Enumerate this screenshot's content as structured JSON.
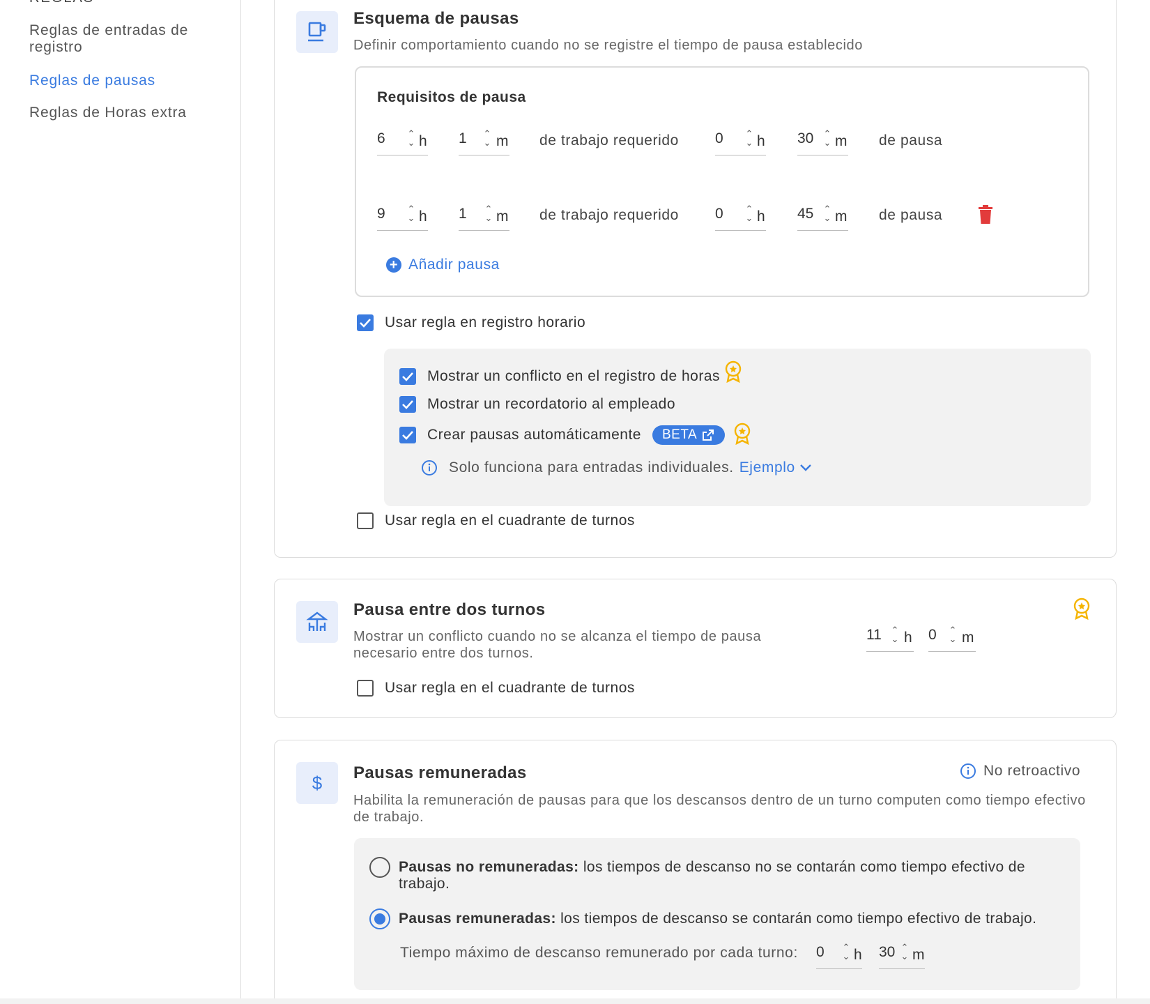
{
  "sidebar": {
    "heading": "REGLAS",
    "items": [
      {
        "label": "Reglas de entradas de registro",
        "active": false
      },
      {
        "label": "Reglas de pausas",
        "active": true
      },
      {
        "label": "Reglas de Horas extra",
        "active": false
      }
    ]
  },
  "break_schema": {
    "title": "Esquema de pausas",
    "description": "Definir comportamiento cuando no se registre el tiempo de pausa establecido",
    "requirements_title": "Requisitos de pausa",
    "rows": [
      {
        "work_h": "6",
        "work_m": "1",
        "work_label": "de trabajo requerido",
        "break_h": "0",
        "break_m": "30",
        "break_label": "de pausa"
      },
      {
        "work_h": "9",
        "work_m": "1",
        "work_label": "de trabajo requerido",
        "break_h": "0",
        "break_m": "45",
        "break_label": "de pausa"
      }
    ],
    "unit_h": "h",
    "unit_m": "m",
    "add_break": "Añadir pausa",
    "use_in_time_tracking": "Usar regla en registro horario",
    "options": {
      "show_conflict": "Mostrar un conflicto en el registro de horas",
      "show_reminder": "Mostrar un recordatorio al empleado",
      "auto_create": "Crear pausas automáticamente",
      "beta": "BETA",
      "info_text": "Solo funciona para entradas individuales.",
      "example_link": "Ejemplo"
    },
    "use_in_shift_schedule": "Usar regla en el cuadrante de turnos"
  },
  "between_shifts": {
    "title": "Pausa entre dos turnos",
    "description": "Mostrar un conflicto cuando no se alcanza el tiempo de pausa necesario entre dos turnos.",
    "hours": "11",
    "minutes": "0",
    "use_in_shift_schedule": "Usar regla en el cuadrante de turnos"
  },
  "paid_breaks": {
    "title": "Pausas remuneradas",
    "non_retroactive": "No retroactivo",
    "description": "Habilita la remuneración de pausas para que los descansos dentro de un turno computen como tiempo efectivo de trabajo.",
    "unpaid_bold": "Pausas no remuneradas:",
    "unpaid_text": " los tiempos de descanso no se contarán como tiempo efectivo de trabajo.",
    "paid_bold": "Pausas remuneradas:",
    "paid_text": " los tiempos de descanso se contarán como tiempo efectivo de trabajo.",
    "max_label": "Tiempo máximo de descanso remunerado por cada turno:",
    "max_h": "0",
    "max_m": "30"
  },
  "colors": {
    "accent": "#3a7be0",
    "danger": "#e23b3b",
    "award": "#f5b400"
  }
}
